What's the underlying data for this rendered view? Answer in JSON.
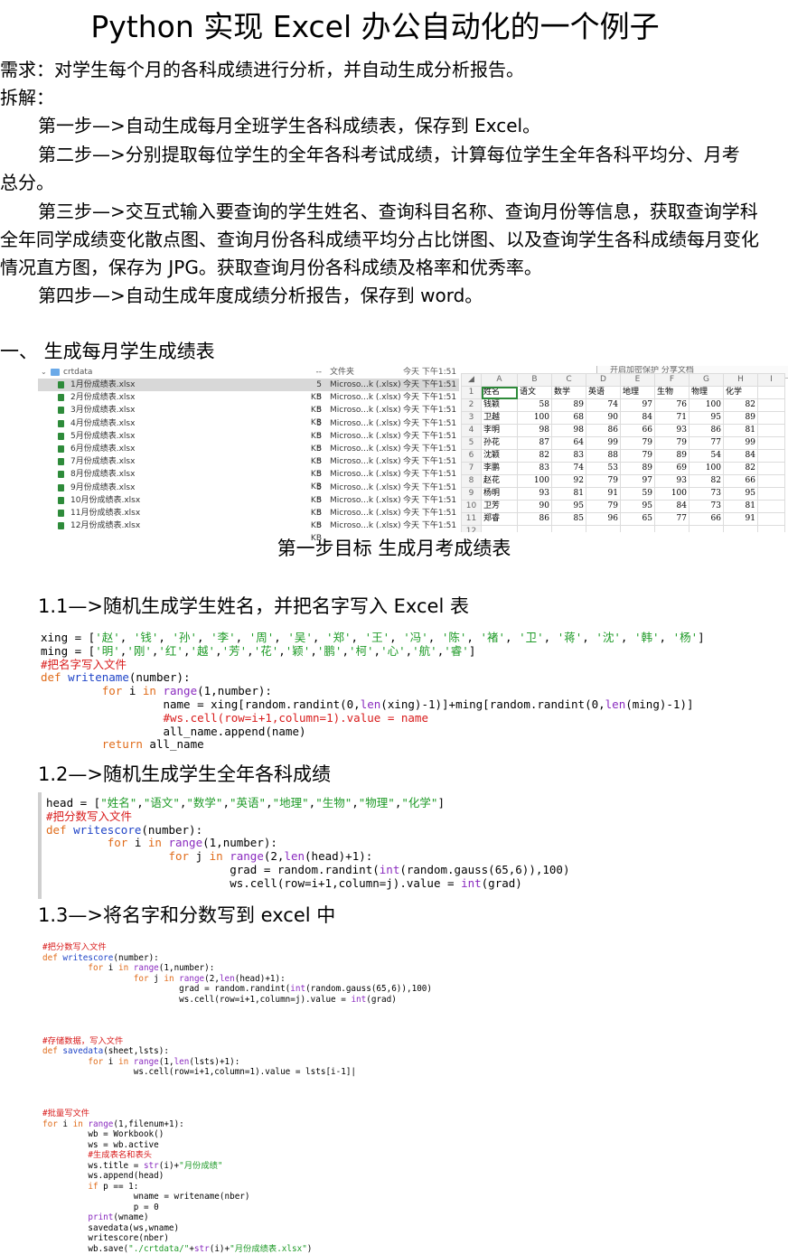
{
  "title": "Python  实现 Excel 办公自动化的一个例子",
  "requirement": "需求：对学生每个月的各科成绩进行分析，并自动生成分析报告。",
  "breakdown_label": "拆解：",
  "steps": [
    "第一步—>自动生成每月全班学生各科成绩表，保存到 Excel。",
    "第二步—>分别提取每位学生的全年各科考试成绩，计算每位学生全年各科平均分、月考总分。",
    "第三步—>交互式输入要查询的学生姓名、查询科目名称、查询月份等信息，获取查询学科全年同学成绩变化散点图、查询月份各科成绩平均分占比饼图、以及查询学生各科成绩每月变化情况直方图，保存为 JPG。获取查询月份各科成绩及格率和优秀率。",
    "第四步—>自动生成年度成绩分析报告，保存到 word。"
  ],
  "section1_heading": "一、  生成每月学生成绩表",
  "finder": {
    "header": {
      "name": "crtdata",
      "size": "--",
      "kind": "文件夹",
      "date": "今天 下午1:51"
    },
    "files": [
      {
        "name": "1月份成绩表.xlsx",
        "size": "5 KB",
        "kind": "Microso...k (.xlsx)",
        "date": "今天 下午1:51"
      },
      {
        "name": "2月份成绩表.xlsx",
        "size": "5 KB",
        "kind": "Microso...k (.xlsx)",
        "date": "今天 下午1:51"
      },
      {
        "name": "3月份成绩表.xlsx",
        "size": "5 KB",
        "kind": "Microso...k (.xlsx)",
        "date": "今天 下午1:51"
      },
      {
        "name": "4月份成绩表.xlsx",
        "size": "5 KB",
        "kind": "Microso...k (.xlsx)",
        "date": "今天 下午1:51"
      },
      {
        "name": "5月份成绩表.xlsx",
        "size": "5 KB",
        "kind": "Microso...k (.xlsx)",
        "date": "今天 下午1:51"
      },
      {
        "name": "6月份成绩表.xlsx",
        "size": "5 KB",
        "kind": "Microso...k (.xlsx)",
        "date": "今天 下午1:51"
      },
      {
        "name": "7月份成绩表.xlsx",
        "size": "5 KB",
        "kind": "Microso...k (.xlsx)",
        "date": "今天 下午1:51"
      },
      {
        "name": "8月份成绩表.xlsx",
        "size": "5 KB",
        "kind": "Microso...k (.xlsx)",
        "date": "今天 下午1:51"
      },
      {
        "name": "9月份成绩表.xlsx",
        "size": "5 KB",
        "kind": "Microso...k (.xlsx)",
        "date": "今天 下午1:51"
      },
      {
        "name": "10月份成绩表.xlsx",
        "size": "5 KB",
        "kind": "Microso...k (.xlsx)",
        "date": "今天 下午1:51"
      },
      {
        "name": "11月份成绩表.xlsx",
        "size": "5 KB",
        "kind": "Microso...k (.xlsx)",
        "date": "今天 下午1:51"
      },
      {
        "name": "12月份成绩表.xlsx",
        "size": "5 KB",
        "kind": "Microso...k (.xlsx)",
        "date": "今天 下午1:51"
      }
    ]
  },
  "sheet": {
    "banner": "开启加密保护    分享文档",
    "col_letters": [
      "A",
      "B",
      "C",
      "D",
      "E",
      "F",
      "G",
      "H",
      "I"
    ],
    "header": [
      "姓名",
      "语文",
      "数学",
      "英语",
      "地理",
      "生物",
      "物理",
      "化学"
    ],
    "rows": [
      [
        "钱颖",
        "58",
        "89",
        "74",
        "97",
        "76",
        "100",
        "82"
      ],
      [
        "卫越",
        "100",
        "68",
        "90",
        "84",
        "71",
        "95",
        "89"
      ],
      [
        "李明",
        "98",
        "98",
        "86",
        "66",
        "93",
        "86",
        "81"
      ],
      [
        "孙花",
        "87",
        "64",
        "99",
        "79",
        "79",
        "77",
        "99"
      ],
      [
        "沈颖",
        "82",
        "83",
        "88",
        "79",
        "89",
        "54",
        "84"
      ],
      [
        "李鹏",
        "83",
        "74",
        "53",
        "89",
        "69",
        "100",
        "82"
      ],
      [
        "赵花",
        "100",
        "92",
        "79",
        "97",
        "93",
        "82",
        "66"
      ],
      [
        "杨明",
        "93",
        "81",
        "91",
        "59",
        "100",
        "73",
        "95"
      ],
      [
        "卫芳",
        "90",
        "95",
        "79",
        "95",
        "84",
        "73",
        "81"
      ],
      [
        "郑睿",
        "86",
        "85",
        "96",
        "65",
        "77",
        "66",
        "91"
      ]
    ],
    "row_numbers": [
      "1",
      "2",
      "3",
      "4",
      "5",
      "6",
      "7",
      "8",
      "9",
      "10",
      "11",
      "12"
    ]
  },
  "caption": "第一步目标  生成月考成绩表",
  "sub_1_1": "1.1—>随机生成学生姓名，并把名字写入 Excel 表",
  "sub_1_2": "1.2—>随机生成学生全年各科成绩",
  "sub_1_3": "1.3—>将名字和分数写到 excel 中"
}
